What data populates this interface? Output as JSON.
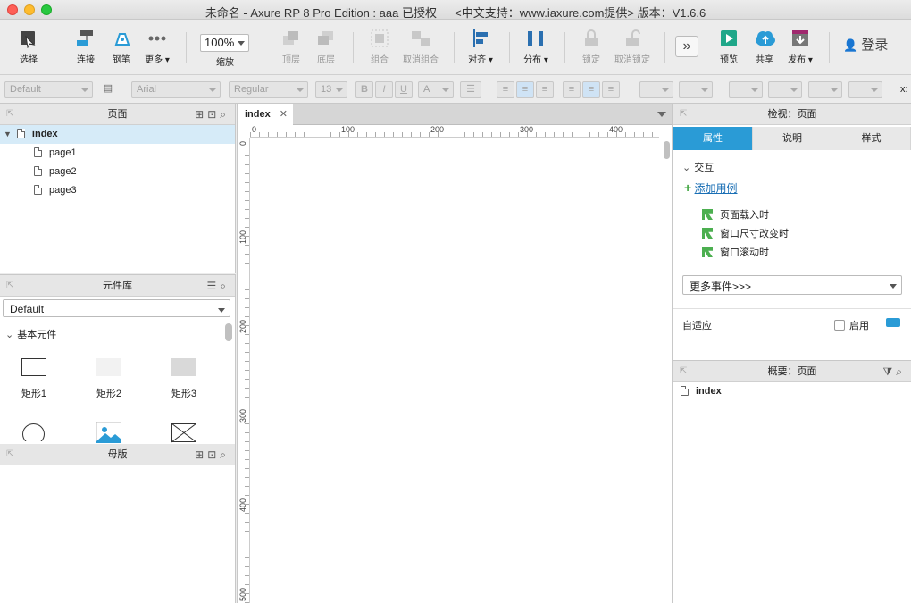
{
  "window": {
    "title": "未命名 - Axure RP 8 Pro Edition : aaa 已授权 　 <中文支持：www.iaxure.com提供> 版本：V1.6.6"
  },
  "toolbar": {
    "select": "选择",
    "connect": "连接",
    "pen": "钢笔",
    "more": "更多 ▾",
    "zoom_value": "100%",
    "zoom_label": "缩放",
    "top": "顶层",
    "bottom": "底层",
    "group": "组合",
    "ungroup": "取消组合",
    "align": "对齐 ▾",
    "distribute": "分布 ▾",
    "lock": "锁定",
    "unlock": "取消锁定",
    "preview": "预览",
    "share": "共享",
    "publish": "发布 ▾",
    "login": "登录"
  },
  "format": {
    "style": "Default",
    "font": "Arial",
    "weight": "Regular",
    "size": "13",
    "bold": "B",
    "italic": "I",
    "underline": "U",
    "fontcolor": "A",
    "x_label": "x:"
  },
  "pages_panel": {
    "title": "页面",
    "items": [
      {
        "label": "index",
        "level": 0
      },
      {
        "label": "page1",
        "level": 1
      },
      {
        "label": "page2",
        "level": 1
      },
      {
        "label": "page3",
        "level": 1
      }
    ]
  },
  "library_panel": {
    "title": "元件库",
    "selected_library": "Default",
    "section": "基本元件",
    "widgets": [
      "矩形1",
      "矩形2",
      "矩形3"
    ]
  },
  "masters_panel": {
    "title": "母版"
  },
  "canvas": {
    "tab_label": "index",
    "ruler_h": [
      "0",
      "100",
      "200",
      "300",
      "400"
    ],
    "ruler_v": [
      "0",
      "100",
      "200",
      "300",
      "400",
      "500"
    ]
  },
  "inspector": {
    "title": "检视：页面",
    "tabs": [
      "属性",
      "说明",
      "样式"
    ],
    "interaction_header": "交互",
    "add_case": "添加用例",
    "events": [
      "页面载入时",
      "窗口尺寸改变时",
      "窗口滚动时"
    ],
    "more_events": "更多事件>>>",
    "adaptive_label": "自适应",
    "enable_label": "启用"
  },
  "outline": {
    "title": "概要：页面",
    "item": "index"
  },
  "colors": {
    "accent": "#2a9bd6",
    "selected_row": "#d6ebf8",
    "green": "#4caf50"
  }
}
